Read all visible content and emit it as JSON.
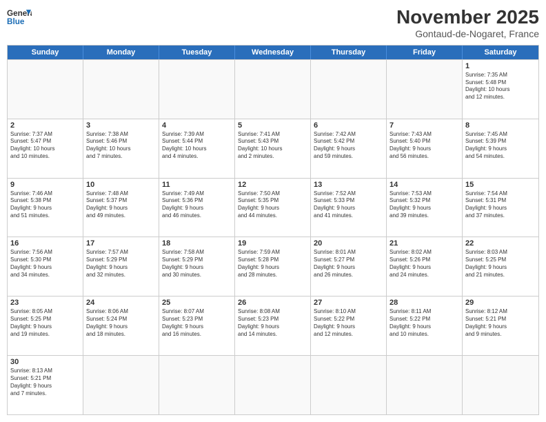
{
  "header": {
    "logo_general": "General",
    "logo_blue": "Blue",
    "month_title": "November 2025",
    "location": "Gontaud-de-Nogaret, France"
  },
  "days_of_week": [
    "Sunday",
    "Monday",
    "Tuesday",
    "Wednesday",
    "Thursday",
    "Friday",
    "Saturday"
  ],
  "weeks": [
    [
      {
        "day": "",
        "info": ""
      },
      {
        "day": "",
        "info": ""
      },
      {
        "day": "",
        "info": ""
      },
      {
        "day": "",
        "info": ""
      },
      {
        "day": "",
        "info": ""
      },
      {
        "day": "",
        "info": ""
      },
      {
        "day": "1",
        "info": "Sunrise: 7:35 AM\nSunset: 5:48 PM\nDaylight: 10 hours\nand 12 minutes."
      }
    ],
    [
      {
        "day": "2",
        "info": "Sunrise: 7:37 AM\nSunset: 5:47 PM\nDaylight: 10 hours\nand 10 minutes."
      },
      {
        "day": "3",
        "info": "Sunrise: 7:38 AM\nSunset: 5:46 PM\nDaylight: 10 hours\nand 7 minutes."
      },
      {
        "day": "4",
        "info": "Sunrise: 7:39 AM\nSunset: 5:44 PM\nDaylight: 10 hours\nand 4 minutes."
      },
      {
        "day": "5",
        "info": "Sunrise: 7:41 AM\nSunset: 5:43 PM\nDaylight: 10 hours\nand 2 minutes."
      },
      {
        "day": "6",
        "info": "Sunrise: 7:42 AM\nSunset: 5:42 PM\nDaylight: 9 hours\nand 59 minutes."
      },
      {
        "day": "7",
        "info": "Sunrise: 7:43 AM\nSunset: 5:40 PM\nDaylight: 9 hours\nand 56 minutes."
      },
      {
        "day": "8",
        "info": "Sunrise: 7:45 AM\nSunset: 5:39 PM\nDaylight: 9 hours\nand 54 minutes."
      }
    ],
    [
      {
        "day": "9",
        "info": "Sunrise: 7:46 AM\nSunset: 5:38 PM\nDaylight: 9 hours\nand 51 minutes."
      },
      {
        "day": "10",
        "info": "Sunrise: 7:48 AM\nSunset: 5:37 PM\nDaylight: 9 hours\nand 49 minutes."
      },
      {
        "day": "11",
        "info": "Sunrise: 7:49 AM\nSunset: 5:36 PM\nDaylight: 9 hours\nand 46 minutes."
      },
      {
        "day": "12",
        "info": "Sunrise: 7:50 AM\nSunset: 5:35 PM\nDaylight: 9 hours\nand 44 minutes."
      },
      {
        "day": "13",
        "info": "Sunrise: 7:52 AM\nSunset: 5:33 PM\nDaylight: 9 hours\nand 41 minutes."
      },
      {
        "day": "14",
        "info": "Sunrise: 7:53 AM\nSunset: 5:32 PM\nDaylight: 9 hours\nand 39 minutes."
      },
      {
        "day": "15",
        "info": "Sunrise: 7:54 AM\nSunset: 5:31 PM\nDaylight: 9 hours\nand 37 minutes."
      }
    ],
    [
      {
        "day": "16",
        "info": "Sunrise: 7:56 AM\nSunset: 5:30 PM\nDaylight: 9 hours\nand 34 minutes."
      },
      {
        "day": "17",
        "info": "Sunrise: 7:57 AM\nSunset: 5:29 PM\nDaylight: 9 hours\nand 32 minutes."
      },
      {
        "day": "18",
        "info": "Sunrise: 7:58 AM\nSunset: 5:29 PM\nDaylight: 9 hours\nand 30 minutes."
      },
      {
        "day": "19",
        "info": "Sunrise: 7:59 AM\nSunset: 5:28 PM\nDaylight: 9 hours\nand 28 minutes."
      },
      {
        "day": "20",
        "info": "Sunrise: 8:01 AM\nSunset: 5:27 PM\nDaylight: 9 hours\nand 26 minutes."
      },
      {
        "day": "21",
        "info": "Sunrise: 8:02 AM\nSunset: 5:26 PM\nDaylight: 9 hours\nand 24 minutes."
      },
      {
        "day": "22",
        "info": "Sunrise: 8:03 AM\nSunset: 5:25 PM\nDaylight: 9 hours\nand 21 minutes."
      }
    ],
    [
      {
        "day": "23",
        "info": "Sunrise: 8:05 AM\nSunset: 5:25 PM\nDaylight: 9 hours\nand 19 minutes."
      },
      {
        "day": "24",
        "info": "Sunrise: 8:06 AM\nSunset: 5:24 PM\nDaylight: 9 hours\nand 18 minutes."
      },
      {
        "day": "25",
        "info": "Sunrise: 8:07 AM\nSunset: 5:23 PM\nDaylight: 9 hours\nand 16 minutes."
      },
      {
        "day": "26",
        "info": "Sunrise: 8:08 AM\nSunset: 5:23 PM\nDaylight: 9 hours\nand 14 minutes."
      },
      {
        "day": "27",
        "info": "Sunrise: 8:10 AM\nSunset: 5:22 PM\nDaylight: 9 hours\nand 12 minutes."
      },
      {
        "day": "28",
        "info": "Sunrise: 8:11 AM\nSunset: 5:22 PM\nDaylight: 9 hours\nand 10 minutes."
      },
      {
        "day": "29",
        "info": "Sunrise: 8:12 AM\nSunset: 5:21 PM\nDaylight: 9 hours\nand 9 minutes."
      }
    ],
    [
      {
        "day": "30",
        "info": "Sunrise: 8:13 AM\nSunset: 5:21 PM\nDaylight: 9 hours\nand 7 minutes."
      },
      {
        "day": "",
        "info": ""
      },
      {
        "day": "",
        "info": ""
      },
      {
        "day": "",
        "info": ""
      },
      {
        "day": "",
        "info": ""
      },
      {
        "day": "",
        "info": ""
      },
      {
        "day": "",
        "info": ""
      }
    ]
  ]
}
